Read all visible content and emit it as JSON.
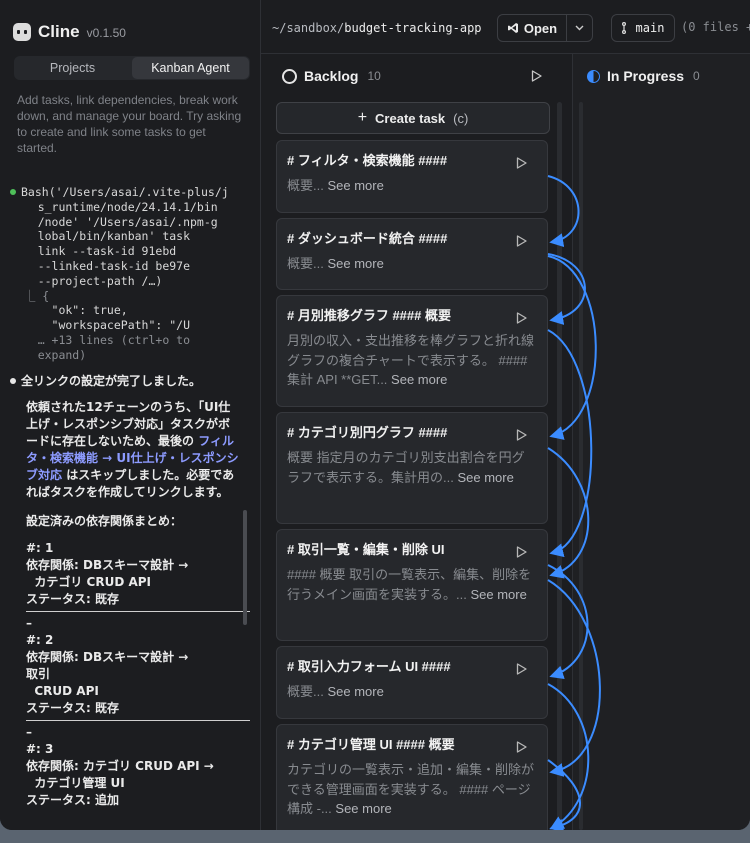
{
  "sidebar": {
    "app_name": "Cline",
    "version": "v0.1.50",
    "tabs": [
      {
        "label": "Projects",
        "active": false
      },
      {
        "label": "Kanban Agent",
        "active": true
      }
    ],
    "hint": "Add tasks, link dependencies, break work down, and manage your board. Try asking to create and link some tasks to get started.",
    "log": {
      "bash_lines": [
        "Bash('/Users/asai/.vite-plus/j",
        "    s_runtime/node/24.14.1/bin",
        "    /node' '/Users/asai/.npm-g",
        "    lobal/bin/kanban' task",
        "    link --task-id 91ebd",
        "    --linked-task-id be97e",
        "    --project-path /…)"
      ],
      "result_lines": [
        "  ⎿ {",
        "      \"ok\": true,",
        "      \"workspacePath\": \"/U",
        "    … +13 lines (ctrl+o to",
        "    expand)"
      ],
      "done_message": "全リンクの設定が完了しました。",
      "para1_before": "依頼された12チェーンのうち、「UI仕上げ・レスポンシブ対応」タスクがボードに存在しないため、最後の ",
      "para1_link": "フィルタ・検索機能 → UI仕上げ・レスポンシブ対応",
      "para1_after": " はスキップしました。必要であればタスクを作成してリンクします。",
      "summary_heading": "設定済みの依存関係まとめ：",
      "entries": [
        {
          "num": "#: 1",
          "dep": "依存関係: DBスキーマ設計 →",
          "dep2": "  カテゴリ CRUD API",
          "status": "ステータス: 既存"
        },
        {
          "num": "#: 2",
          "dep": "依存関係: DBスキーマ設計 →",
          "dep2": "取引\n  CRUD API",
          "status": "ステータス: 既存"
        },
        {
          "num": "#: 3",
          "dep": "依存関係: カテゴリ CRUD API →",
          "dep2": "  カテゴリ管理 UI",
          "status": "ステータス: 追加"
        }
      ],
      "separator_char": "–"
    }
  },
  "topbar": {
    "path_prefix": "~/sandbox/",
    "path_name": "budget-tracking-app",
    "open_label": "Open",
    "branch": "main",
    "files_text": "(0 files +"
  },
  "backlog": {
    "title": "Backlog",
    "count": "10",
    "create_label": "Create task",
    "create_shortcut": "(c)",
    "cards": [
      {
        "title": "# フィルタ・検索機能 ####",
        "desc": "概要...",
        "more": "See more"
      },
      {
        "title": "# ダッシュボード統合 ####",
        "desc": "概要...",
        "more": "See more"
      },
      {
        "title": "# 月別推移グラフ #### 概要",
        "desc": "月別の収入・支出推移を棒グラフと折れ線グラフの複合チャートで表示する。 #### 集計 API **GET...",
        "more": "See more"
      },
      {
        "title": "# カテゴリ別円グラフ ####",
        "desc": "概要 指定月のカテゴリ別支出割合を円グラフで表示する。集計用の...",
        "more": "See more"
      },
      {
        "title": "# 取引一覧・編集・削除 UI",
        "desc": "#### 概要 取引の一覧表示、編集、削除を行うメイン画面を実装する。...",
        "more": "See more"
      },
      {
        "title": "# 取引入力フォーム UI ####",
        "desc": "概要...",
        "more": "See more"
      },
      {
        "title": "# カテゴリ管理 UI #### 概要",
        "desc": "カテゴリの一覧表示・追加・編集・削除ができる管理画面を実装する。 #### ページ構成 -...",
        "more": "See more"
      }
    ]
  },
  "in_progress": {
    "title": "In Progress",
    "count": "0"
  },
  "colors": {
    "accent_blue": "#3b8cff",
    "status_green": "#4fc05a",
    "link_purple": "#8d9bff"
  }
}
